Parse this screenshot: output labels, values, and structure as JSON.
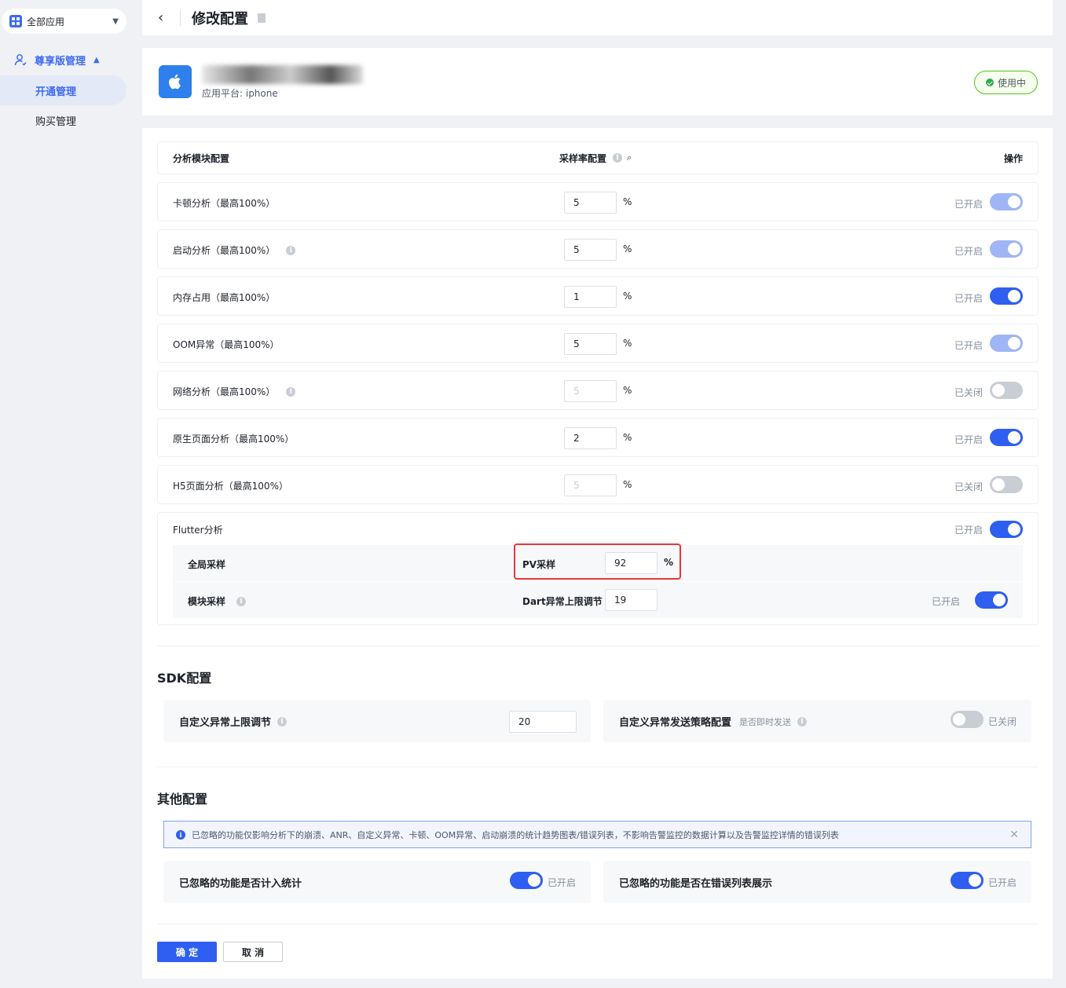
{
  "sidebar": {
    "app_select": "全部应用",
    "group": "尊享版管理",
    "items": [
      {
        "label": "开通管理"
      },
      {
        "label": "购买管理"
      }
    ]
  },
  "header": {
    "title": "修改配置"
  },
  "app": {
    "platform": "应用平台: iphone",
    "status": "使用中"
  },
  "table": {
    "col_module": "分析模块配置",
    "col_rate": "采样率配置",
    "col_action": "操作",
    "pct_unit": "%",
    "rows": [
      {
        "name": "卡顿分析（最高100%）",
        "rate": "5",
        "state": "已开启"
      },
      {
        "name": "启动分析（最高100%）",
        "rate": "5",
        "state": "已开启"
      },
      {
        "name": "内存占用（最高100%）",
        "rate": "1",
        "state": "已开启"
      },
      {
        "name": "OOM异常（最高100%）",
        "rate": "5",
        "state": "已开启"
      },
      {
        "name": "网络分析（最高100%）",
        "rate": "5",
        "state": "已关闭"
      },
      {
        "name": "原生页面分析（最高100%）",
        "rate": "2",
        "state": "已开启"
      },
      {
        "name": "H5页面分析（最高100%）",
        "rate": "5",
        "state": "已关闭"
      }
    ],
    "flutter": {
      "name": "Flutter分析",
      "state": "已开启",
      "global": {
        "name": "全局采样",
        "key": "PV采样",
        "value": "92",
        "unit": "%"
      },
      "module": {
        "name": "模块采样",
        "key": "Dart异常上限调节",
        "value": "19",
        "state": "已开启"
      }
    }
  },
  "sdk": {
    "title": "SDK配置",
    "limit": {
      "label": "自定义异常上限调节",
      "value": "20"
    },
    "policy": {
      "label": "自定义异常发送策略配置",
      "hint": "是否即时发送",
      "state": "已关闭"
    }
  },
  "other": {
    "title": "其他配置",
    "notice": "已忽略的功能仅影响分析下的崩溃、ANR、自定义异常、卡顿、OOM异常、启动崩溃的统计趋势图表/错误列表，不影响告警监控的数据计算以及告警监控详情的错误列表",
    "count": {
      "label": "已忽略的功能是否计入统计",
      "state": "已开启"
    },
    "show": {
      "label": "已忽略的功能是否在错误列表展示",
      "state": "已开启"
    }
  },
  "buttons": {
    "confirm": "确 定",
    "cancel": "取 消"
  }
}
